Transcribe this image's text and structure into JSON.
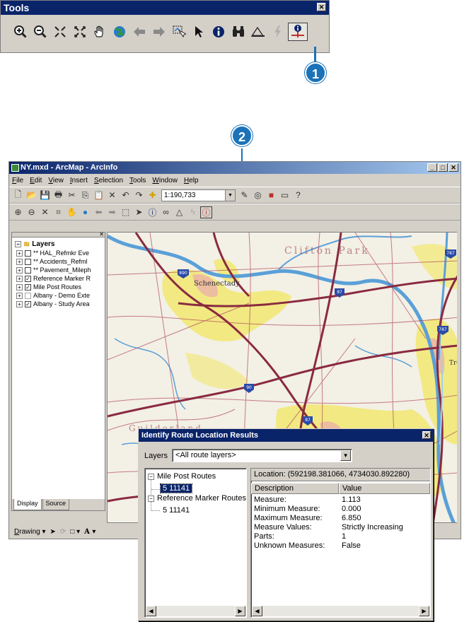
{
  "tools_window": {
    "title": "Tools",
    "close_glyph": "✕",
    "icons": [
      "zoom-in-icon",
      "zoom-out-icon",
      "fixed-zoom-in-icon",
      "fixed-zoom-out-icon",
      "pan-hand-icon",
      "full-extent-globe-icon",
      "back-arrow-icon",
      "forward-arrow-icon",
      "select-features-icon",
      "select-elements-arrow-icon",
      "identify-info-icon",
      "find-binoculars-icon",
      "measure-icon",
      "hyperlink-lightning-icon",
      "identify-route-location-icon"
    ],
    "active_tool": "identify-route-location-icon"
  },
  "callouts": {
    "one": "1",
    "two": "2"
  },
  "arcmap": {
    "title": "NY.mxd - ArcMap - ArcInfo",
    "menu": [
      "File",
      "Edit",
      "View",
      "Insert",
      "Selection",
      "Tools",
      "Window",
      "Help"
    ],
    "scale": "1:190,733",
    "toc": {
      "root": "Layers",
      "layers": [
        {
          "label": "** HAL_Refmkr Eve",
          "checked": false
        },
        {
          "label": "** Accidents_Refml",
          "checked": false
        },
        {
          "label": "** Pavement_Mileph",
          "checked": false
        },
        {
          "label": "Reference Marker R",
          "checked": true
        },
        {
          "label": "Mile Post Routes",
          "checked": true
        },
        {
          "label": "Albany - Demo Exte",
          "checked": false
        },
        {
          "label": "Albany - Study Area",
          "checked": true
        }
      ],
      "tabs": [
        "Display",
        "Source"
      ]
    },
    "drawing_label": "Drawing ▾",
    "map_labels": [
      "Clifton Park",
      "Schenectady",
      "Troy",
      "Guilderland"
    ],
    "route_shields": [
      "890",
      "87",
      "90",
      "87",
      "787"
    ]
  },
  "identify": {
    "title": "Identify Route Location Results",
    "layers_label": "Layers",
    "layers_value": "<All route layers>",
    "tree": [
      {
        "label": "Mile Post Routes",
        "child": "5 11141",
        "selected": true
      },
      {
        "label": "Reference Marker Routes",
        "child": "5 11141",
        "selected": false
      }
    ],
    "location": "Location: (592198.381066, 4734030.892280)",
    "columns": [
      "Description",
      "Value"
    ],
    "rows": [
      {
        "description": "Measure:",
        "value": "1.113"
      },
      {
        "description": "Minimum Measure:",
        "value": "0.000"
      },
      {
        "description": "Maximum Measure:",
        "value": "6.850"
      },
      {
        "description": "Measure Values:",
        "value": "Strictly Increasing"
      },
      {
        "description": "Parts:",
        "value": "1"
      },
      {
        "description": "Unknown Measures:",
        "value": "False"
      }
    ]
  },
  "colors": {
    "title_bar": "#0a246a",
    "callout": "#1a72b8",
    "urban": "#f1e870",
    "highway": "#8a2a40",
    "water": "#5aa0d8"
  }
}
